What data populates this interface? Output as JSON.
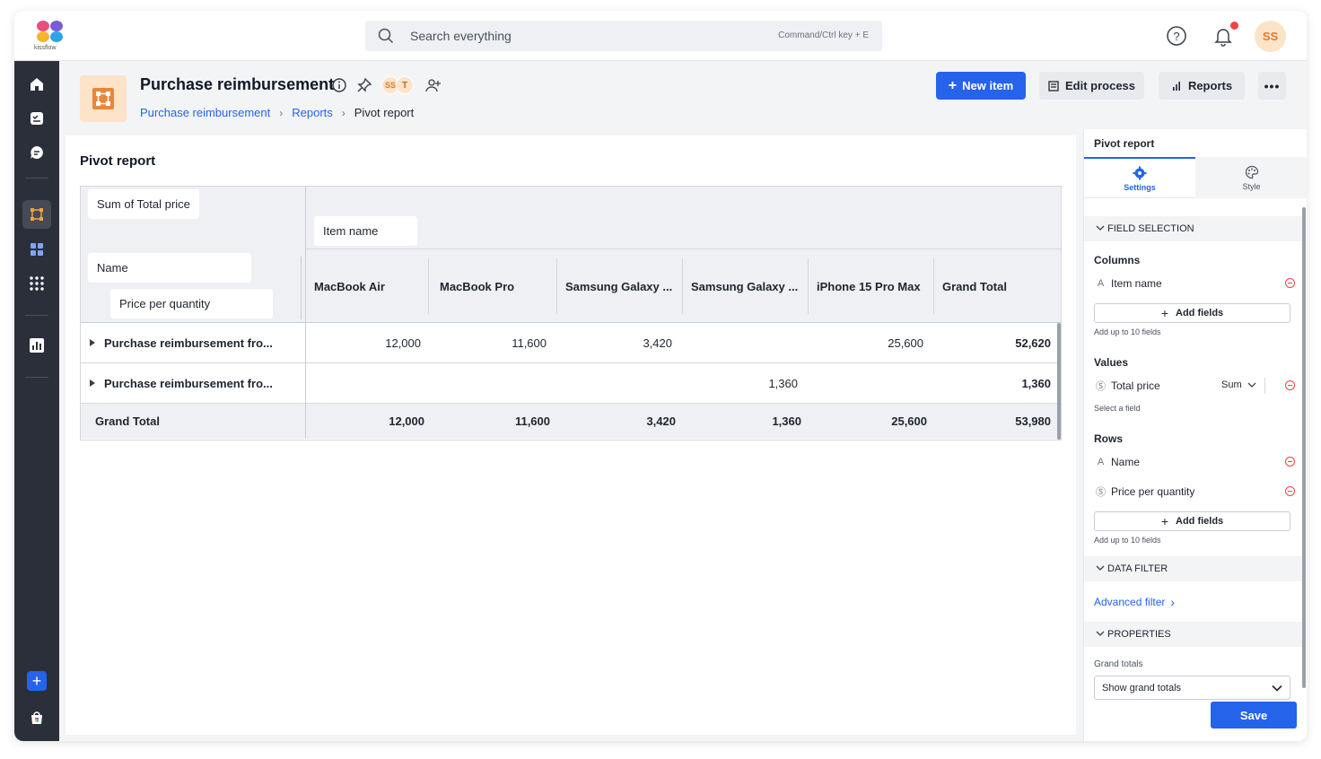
{
  "app": {
    "logo_text": "kissflow",
    "user_initials": "SS"
  },
  "search": {
    "placeholder": "Search everything",
    "shortcut": "Command/Ctrl key + E"
  },
  "sidebar": {
    "items": [
      "home-icon",
      "tasks-icon",
      "chat-icon",
      "process-icon",
      "apps-icon",
      "grid-icon",
      "analytics-icon"
    ],
    "active_index": 3
  },
  "header": {
    "title": "Purchase reimbursement",
    "members": [
      "SS",
      "T"
    ],
    "breadcrumb": [
      {
        "label": "Purchase reimbursement"
      },
      {
        "label": "Reports"
      },
      {
        "label": "Pivot report"
      }
    ],
    "buttons": {
      "new_item": "New item",
      "edit_process": "Edit process",
      "reports": "Reports"
    }
  },
  "pivot": {
    "title": "Pivot report",
    "value_chip": "Sum of Total price",
    "column_chip": "Item name",
    "row_chips": [
      "Name",
      "Price per quantity"
    ],
    "columns": [
      "MacBook Air",
      "MacBook Pro",
      "Samsung Galaxy ...",
      "Samsung Galaxy ...",
      "iPhone 15 Pro Max",
      "Grand Total"
    ],
    "rows": [
      {
        "label": "Purchase reimbursement fro...",
        "values": [
          "12,000",
          "11,600",
          "3,420",
          "",
          "25,600",
          "52,620"
        ]
      },
      {
        "label": "Purchase reimbursement fro...",
        "values": [
          "",
          "",
          "",
          "1,360",
          "",
          "1,360"
        ]
      }
    ],
    "total": {
      "label": "Grand Total",
      "values": [
        "12,000",
        "11,600",
        "3,420",
        "1,360",
        "25,600",
        "53,980"
      ]
    }
  },
  "panel": {
    "title": "Pivot report",
    "tabs": [
      "Settings",
      "Style"
    ],
    "field_selection": "FIELD SELECTION",
    "columns_label": "Columns",
    "column_field": "Item name",
    "add_fields": "Add fields",
    "add_hint": "Add up to 10 fields",
    "values_label": "Values",
    "value_field": "Total price",
    "value_agg": "Sum",
    "select_hint": "Select a field",
    "rows_label": "Rows",
    "row_fields": [
      "Name",
      "Price per quantity"
    ],
    "data_filter": "DATA FILTER",
    "advanced_filter": "Advanced filter",
    "properties": "PROPERTIES",
    "grand_totals_label": "Grand totals",
    "grand_totals_value": "Show grand totals",
    "save": "Save"
  },
  "colors": {
    "primary": "#2563eb",
    "sidebar": "#2b2f3a",
    "accent_orange": "#e07a2a",
    "danger": "#ef4444"
  }
}
